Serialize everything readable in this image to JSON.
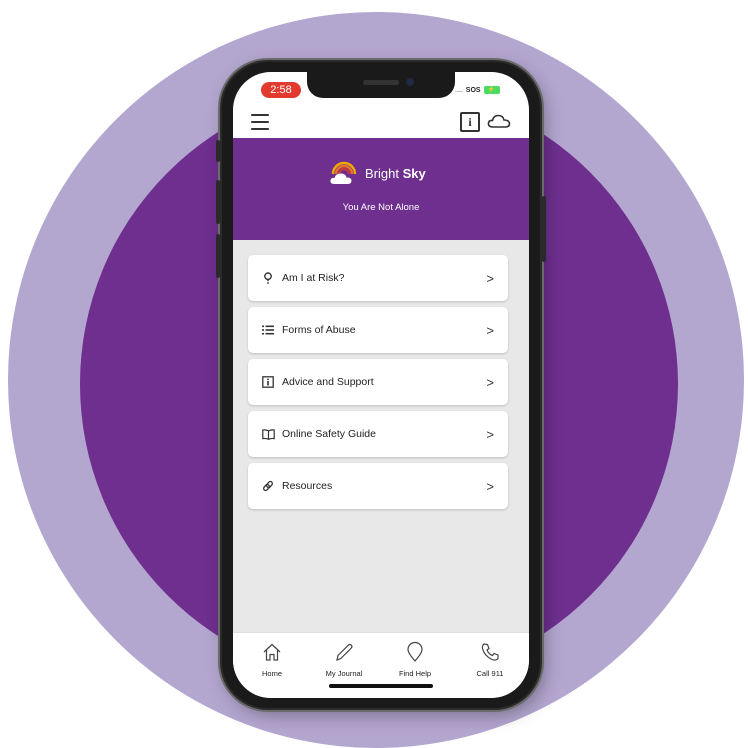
{
  "status_bar": {
    "time": "2:58",
    "carrier": "SOS"
  },
  "brand": {
    "name_light": "Bright",
    "name_bold": "Sky",
    "tagline": "You Are Not Alone"
  },
  "menu": [
    {
      "label": "Am I at Risk?",
      "icon": "question-icon"
    },
    {
      "label": "Forms of Abuse",
      "icon": "list-icon"
    },
    {
      "label": "Advice and Support",
      "icon": "info-icon"
    },
    {
      "label": "Online Safety Guide",
      "icon": "book-icon"
    },
    {
      "label": "Resources",
      "icon": "link-icon"
    }
  ],
  "bottom_nav": [
    {
      "label": "Home",
      "icon": "home-icon"
    },
    {
      "label": "My Journal",
      "icon": "pencil-icon"
    },
    {
      "label": "Find Help",
      "icon": "map-pin-icon"
    },
    {
      "label": "Call 911",
      "icon": "phone-icon"
    }
  ],
  "colors": {
    "brand_purple": "#6e2f8f",
    "outer_ring": "#b3a6cf",
    "time_pill": "#e23a2e"
  }
}
